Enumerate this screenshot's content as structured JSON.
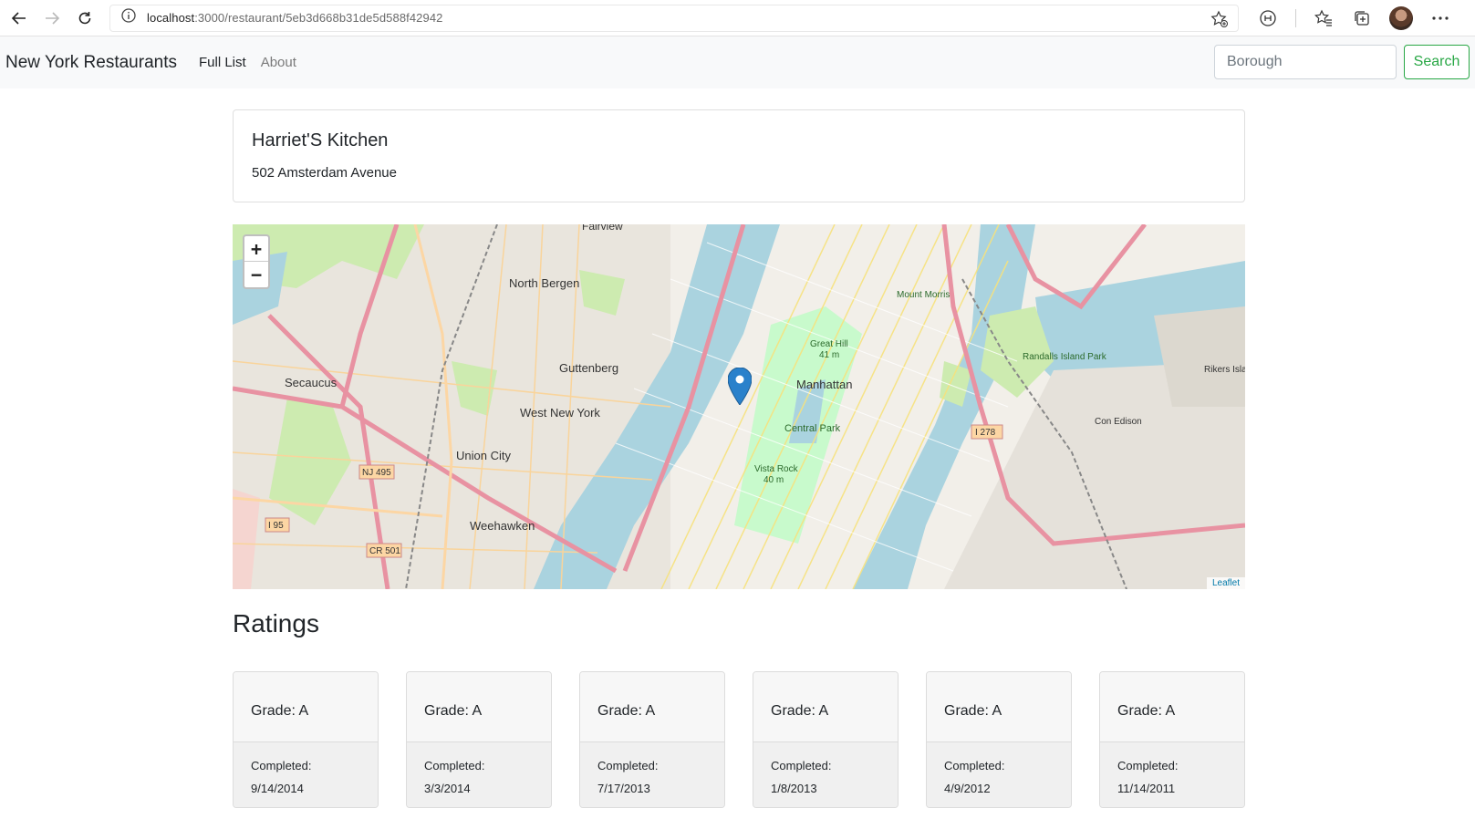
{
  "browser": {
    "url_host": "localhost",
    "url_rest": ":3000/restaurant/5eb3d668b31de5d588f42942"
  },
  "navbar": {
    "brand": "New York Restaurants",
    "links": [
      "Full List",
      "About"
    ],
    "search_placeholder": "Borough",
    "search_button": "Search"
  },
  "restaurant": {
    "name": "Harriet'S Kitchen",
    "address": "502 Amsterdam Avenue"
  },
  "map": {
    "zoom_in": "+",
    "zoom_out": "−",
    "attribution": "Leaflet",
    "labels": {
      "fairview": "Fairview",
      "north_bergen": "North Bergen",
      "guttenberg": "Guttenberg",
      "secaucus": "Secaucus",
      "west_new_york": "West New York",
      "union_city": "Union City",
      "weehawken": "Weehawken",
      "manhattan": "Manhattan",
      "great_hill": "Great Hill",
      "great_hill_elev": "41 m",
      "central_park": "Central Park",
      "vista_rock": "Vista Rock",
      "vista_rock_elev": "40 m",
      "mount_morris": "Mount Morris",
      "randalls_island": "Randalls Island Park",
      "con_edison": "Con Edison",
      "rikers": "Rikers Isla",
      "i278": "I 278",
      "nj495": "NJ 495",
      "i95": "I 95",
      "cr501": "CR 501"
    }
  },
  "ratings": {
    "title": "Ratings",
    "items": [
      {
        "grade": "Grade: A",
        "completed_label": "Completed:",
        "date": "9/14/2014"
      },
      {
        "grade": "Grade: A",
        "completed_label": "Completed:",
        "date": "3/3/2014"
      },
      {
        "grade": "Grade: A",
        "completed_label": "Completed:",
        "date": "7/17/2013"
      },
      {
        "grade": "Grade: A",
        "completed_label": "Completed:",
        "date": "1/8/2013"
      },
      {
        "grade": "Grade: A",
        "completed_label": "Completed:",
        "date": "4/9/2012"
      },
      {
        "grade": "Grade: A",
        "completed_label": "Completed:",
        "date": "11/14/2011"
      }
    ]
  },
  "colors": {
    "success": "#28a745",
    "water": "#aad3df",
    "park": "#c8facc",
    "road_major": "#e892a2",
    "road_minor": "#f9d49b",
    "marker": "#2a81cb"
  }
}
